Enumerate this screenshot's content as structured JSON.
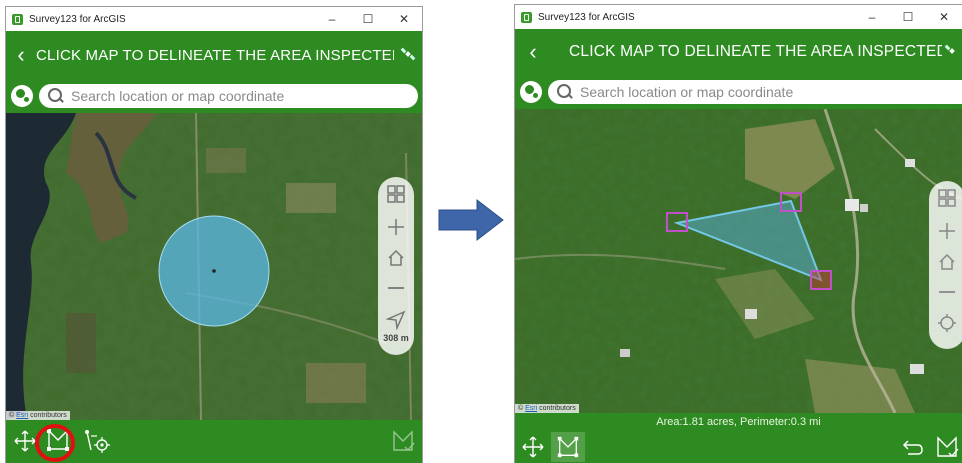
{
  "left_window": {
    "title": "Survey123 for ArcGIS",
    "header_title": "CLICK MAP TO DELINEATE THE AREA INSPECTED",
    "search_placeholder": "Search location or map coordinate",
    "scale_label": "308 m",
    "attribution": {
      "provider": "Esri",
      "text": " contributors"
    }
  },
  "right_window": {
    "title": "Survey123 for ArcGIS",
    "header_title": "CLICK MAP TO DELINEATE THE AREA INSPECTED",
    "search_placeholder": "Search location or map coordinate",
    "attribution": {
      "provider": "Esri",
      "text": " contributors"
    },
    "area_summary": "Area:1.81 acres, Perimeter:0.3 mi"
  },
  "window_controls": {
    "minimize": "–",
    "maximize": "☐",
    "close": "✕"
  },
  "colors": {
    "header_green": "#2e8b22",
    "buffer_blue": "#5bb8e6",
    "polygon_fill": "#55aacc",
    "vertex_magenta": "#c04fc8",
    "highlight_red": "#e01010",
    "arrow_blue": "#3f66a8"
  },
  "icons": {
    "header_right": "satellite-icon",
    "search_left": "globe-location-icon",
    "toolbar_left": [
      "move-arrows-icon",
      "polygon-draw-icon",
      "gps-track-icon"
    ],
    "toolbar_right_left_window": [
      "polygon-confirm-icon"
    ],
    "toolbar_right_right_window": [
      "undo-icon",
      "polygon-confirm-icon"
    ],
    "zoom_controls": [
      "basemap-gallery-icon",
      "zoom-in-icon",
      "home-icon",
      "zoom-out-icon",
      "locate-icon"
    ]
  }
}
